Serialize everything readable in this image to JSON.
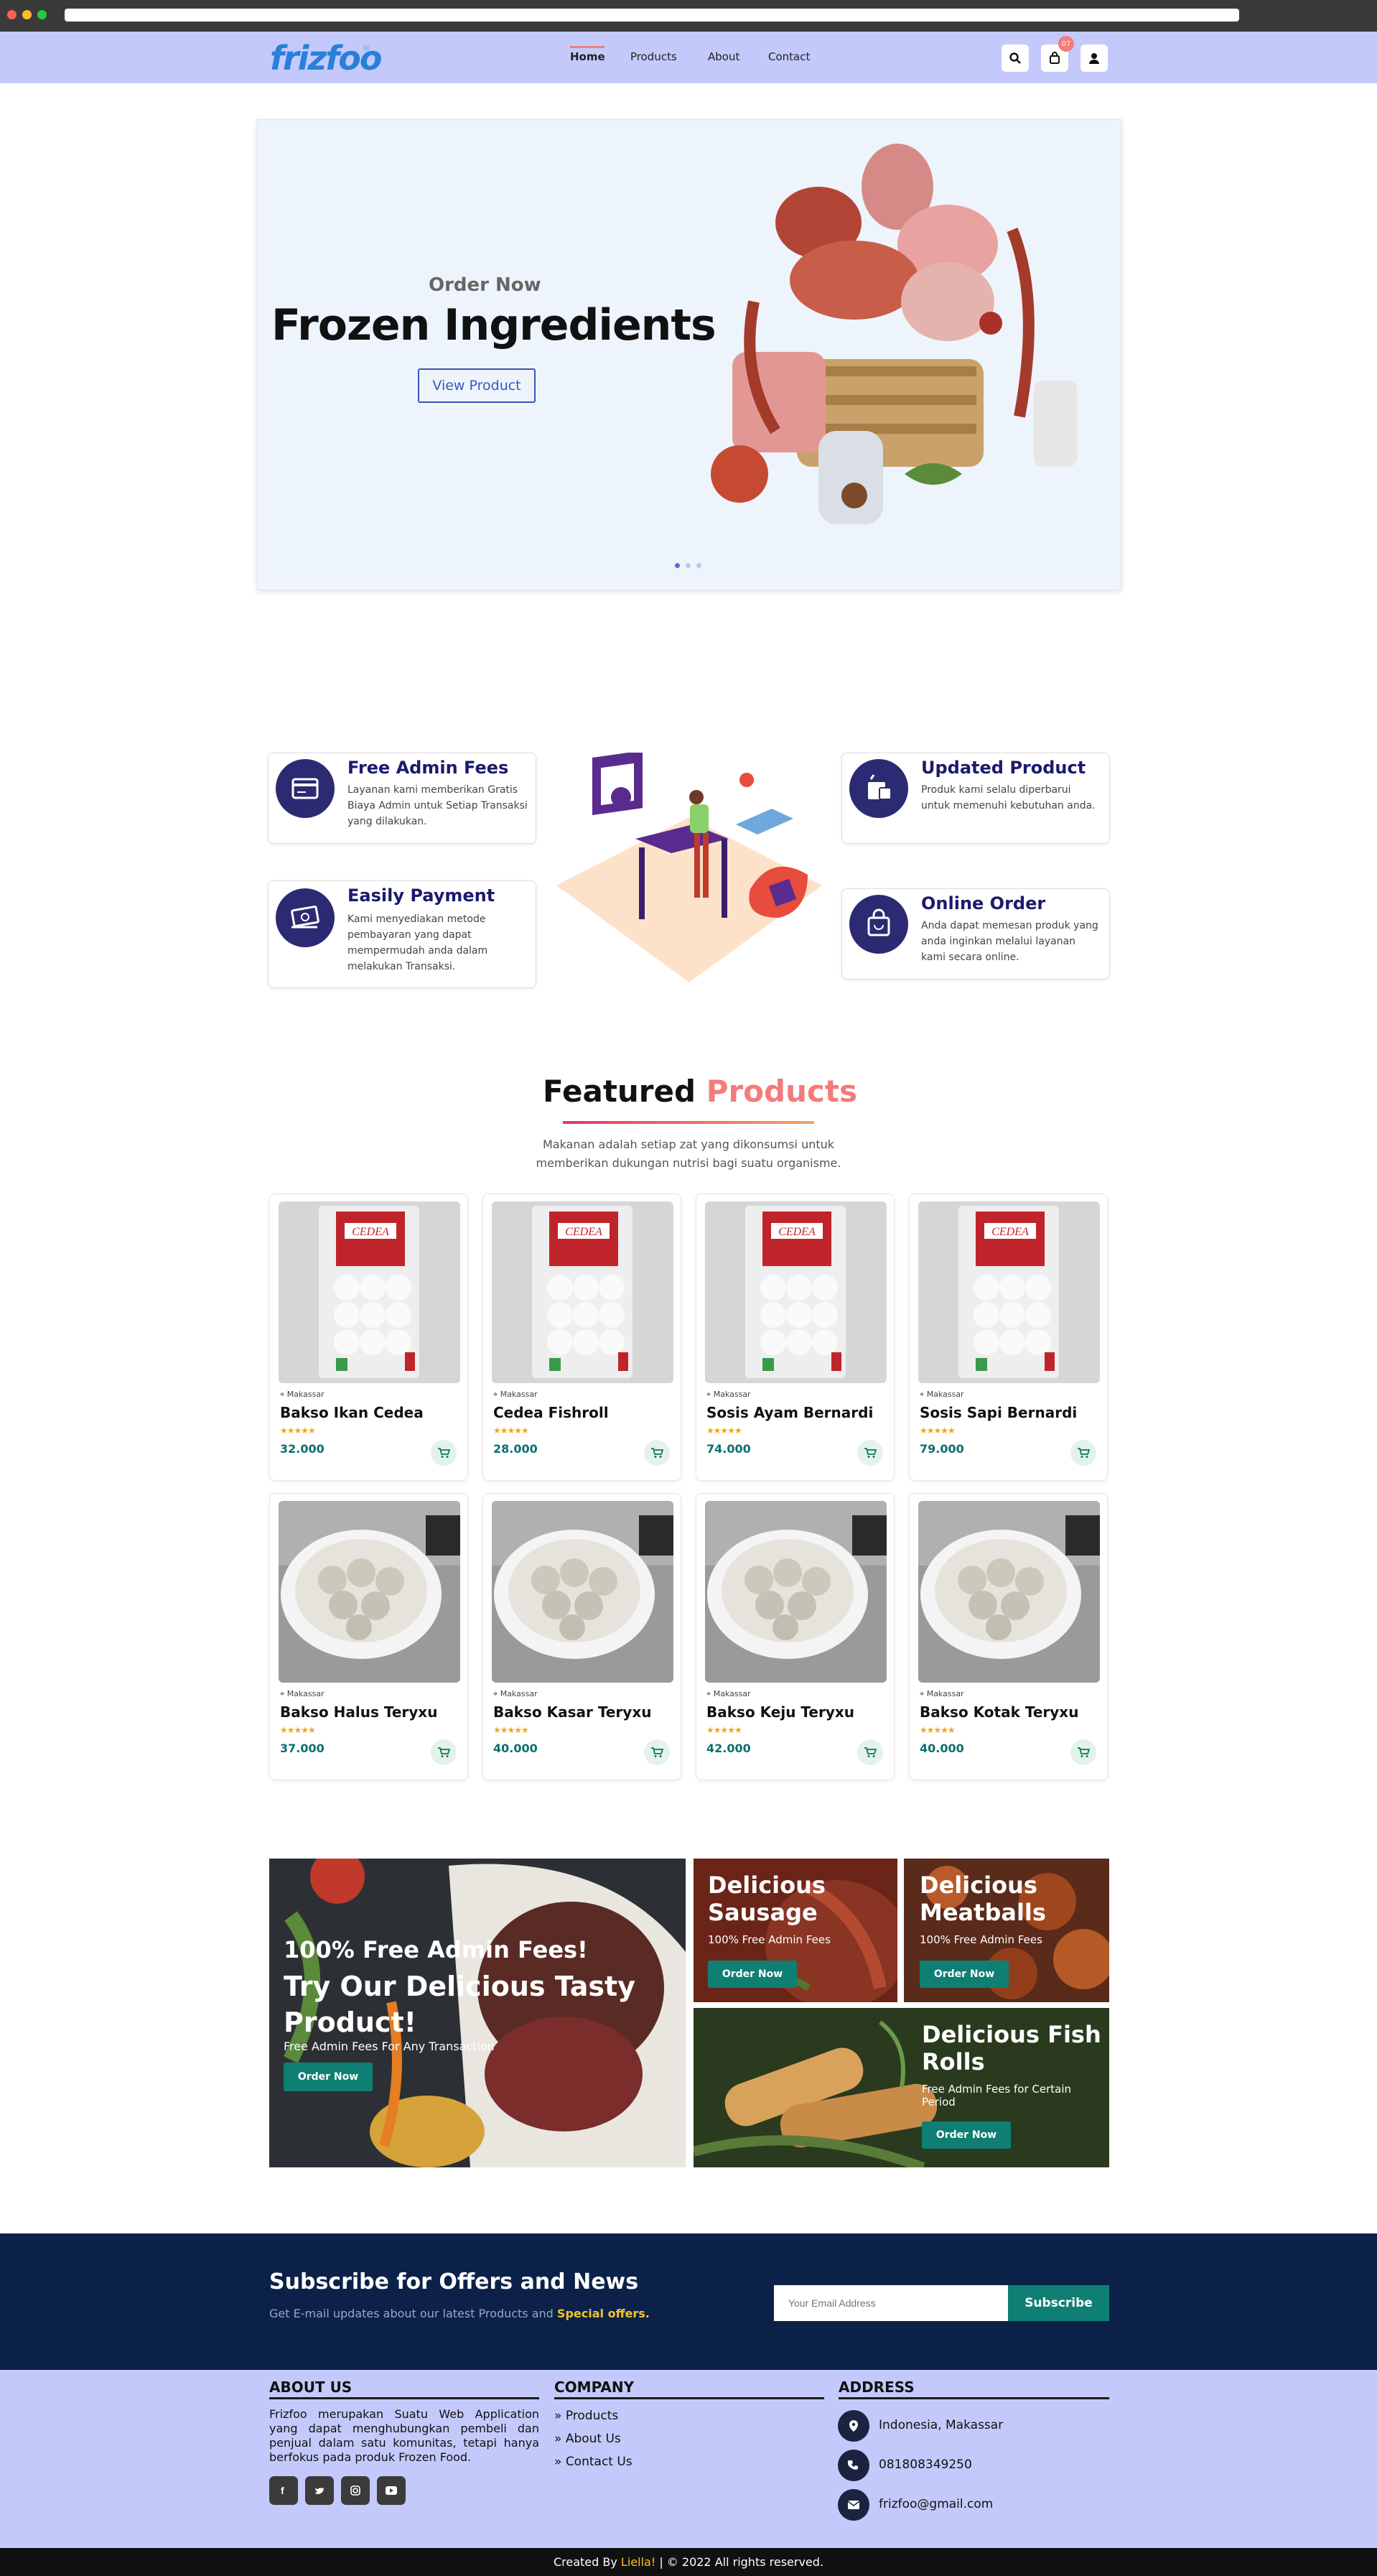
{
  "brand": {
    "logo": "frizfoo"
  },
  "nav": {
    "links": [
      "Home",
      "Products",
      "About",
      "Contact"
    ],
    "cart_count": "07"
  },
  "hero": {
    "kicker": "Order Now",
    "title": "Frozen Ingredients",
    "button": "View Product",
    "slides": 3
  },
  "features": [
    {
      "title": "Free Admin Fees",
      "desc": "Layanan kami memberikan Gratis Biaya Admin untuk Setiap Transaksi yang dilakukan.",
      "icon": "card-icon"
    },
    {
      "title": "Easily Payment",
      "desc": "Kami menyediakan metode pembayaran yang dapat mempermudah anda dalam melakukan Transaksi.",
      "icon": "cash-icon"
    },
    {
      "title": "Updated Product",
      "desc": "Produk kami selalu diperbarui untuk memenuhi kebutuhan anda.",
      "icon": "food-bag-icon"
    },
    {
      "title": "Online Order",
      "desc": "Anda dapat memesan produk yang anda inginkan melalui layanan kami secara online.",
      "icon": "shopping-bag-icon"
    }
  ],
  "featured": {
    "title_a": "Featured",
    "title_b": "Products",
    "subtitle": "Makanan adalah setiap zat yang dikonsumsi untuk memberikan dukungan nutrisi bagi suatu organisme."
  },
  "products": [
    {
      "loc": "Makassar",
      "name": "Bakso Ikan Cedea",
      "price": "32.000",
      "stars": "★★★★★",
      "img": "pack"
    },
    {
      "loc": "Makassar",
      "name": "Cedea Fishroll",
      "price": "28.000",
      "stars": "★★★★★",
      "img": "pack"
    },
    {
      "loc": "Makassar",
      "name": "Sosis Ayam Bernardi",
      "price": "74.000",
      "stars": "★★★★★",
      "img": "pack"
    },
    {
      "loc": "Makassar",
      "name": "Sosis Sapi Bernardi",
      "price": "79.000",
      "stars": "★★★★★",
      "img": "pack"
    },
    {
      "loc": "Makassar",
      "name": "Bakso Halus Teryxu",
      "price": "37.000",
      "stars": "★★★★★",
      "img": "bowl"
    },
    {
      "loc": "Makassar",
      "name": "Bakso Kasar Teryxu",
      "price": "40.000",
      "stars": "★★★★★",
      "img": "bowl"
    },
    {
      "loc": "Makassar",
      "name": "Bakso Keju Teryxu",
      "price": "42.000",
      "stars": "★★★★★",
      "img": "bowl"
    },
    {
      "loc": "Makassar",
      "name": "Bakso Kotak Teryxu",
      "price": "40.000",
      "stars": "★★★★★",
      "img": "bowl"
    }
  ],
  "promos": {
    "big": {
      "line1": "100% Free Admin Fees!",
      "line2": "Try Our Delicious Tasty",
      "line3": "Product!",
      "sub": "Free Admin Fees For Any Transaction",
      "button": "Order Now"
    },
    "sausage": {
      "title1": "Delicious",
      "title2": "Sausage",
      "sub": "100% Free Admin Fees",
      "button": "Order Now"
    },
    "meatballs": {
      "title1": "Delicious",
      "title2": "Meatballs",
      "sub": "100% Free Admin Fees",
      "button": "Order Now"
    },
    "fishrolls": {
      "title1": "Delicious Fish",
      "title2": "Rolls",
      "sub1": "Free Admin Fees for Certain",
      "sub2": "Period",
      "button": "Order Now"
    }
  },
  "subscribe": {
    "title": "Subscribe for Offers and News",
    "text_a": "Get E-mail updates about our latest Products and",
    "text_b": "Special offers.",
    "placeholder": "Your Email Address",
    "button": "Subscribe"
  },
  "footer": {
    "about_head": "ABOUT US",
    "about_text": "Frizfoo merupakan Suatu Web Application yang dapat menghubungkan pembeli dan penjual dalam satu komunitas, tetapi hanya berfokus pada produk Frozen Food.",
    "company_head": "COMPANY",
    "company_links": [
      "Products",
      "About Us",
      "Contact Us"
    ],
    "address_head": "ADDRESS",
    "address": "Indonesia, Makassar",
    "phone": "081808349250",
    "email": "frizfoo@gmail.com",
    "socials": [
      "facebook-icon",
      "twitter-icon",
      "instagram-icon",
      "youtube-icon"
    ]
  },
  "copyright": {
    "a": "Created By",
    "author": "Liella!",
    "b": "| © 2022 All rights reserved."
  }
}
